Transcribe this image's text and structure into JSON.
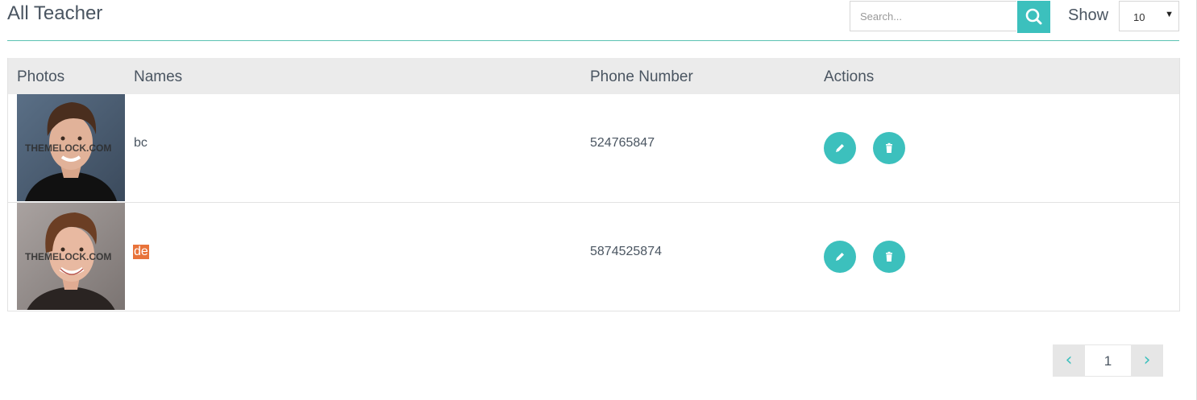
{
  "header": {
    "title": "All Teacher",
    "search_placeholder": "Search...",
    "search_icon": "search-icon",
    "show_label": "Show",
    "show_value": "10"
  },
  "table": {
    "columns": [
      "Photos",
      "Names",
      "Phone Number",
      "Actions"
    ],
    "rows": [
      {
        "photo_watermark": "THEMELOCK.COM",
        "name": "bc",
        "phone": "524765847"
      },
      {
        "photo_watermark": "THEMELOCK.COM",
        "name": "de",
        "phone": "5874525874"
      }
    ],
    "actions": {
      "edit_icon": "pencil-icon",
      "delete_icon": "trash-icon"
    }
  },
  "pagination": {
    "prev": "‹",
    "current": "1",
    "next": "›"
  },
  "colors": {
    "accent": "#3cc0bd",
    "rule": "#5bc2b2",
    "header_bg": "#ebebeb",
    "highlight": "#e8733a"
  }
}
